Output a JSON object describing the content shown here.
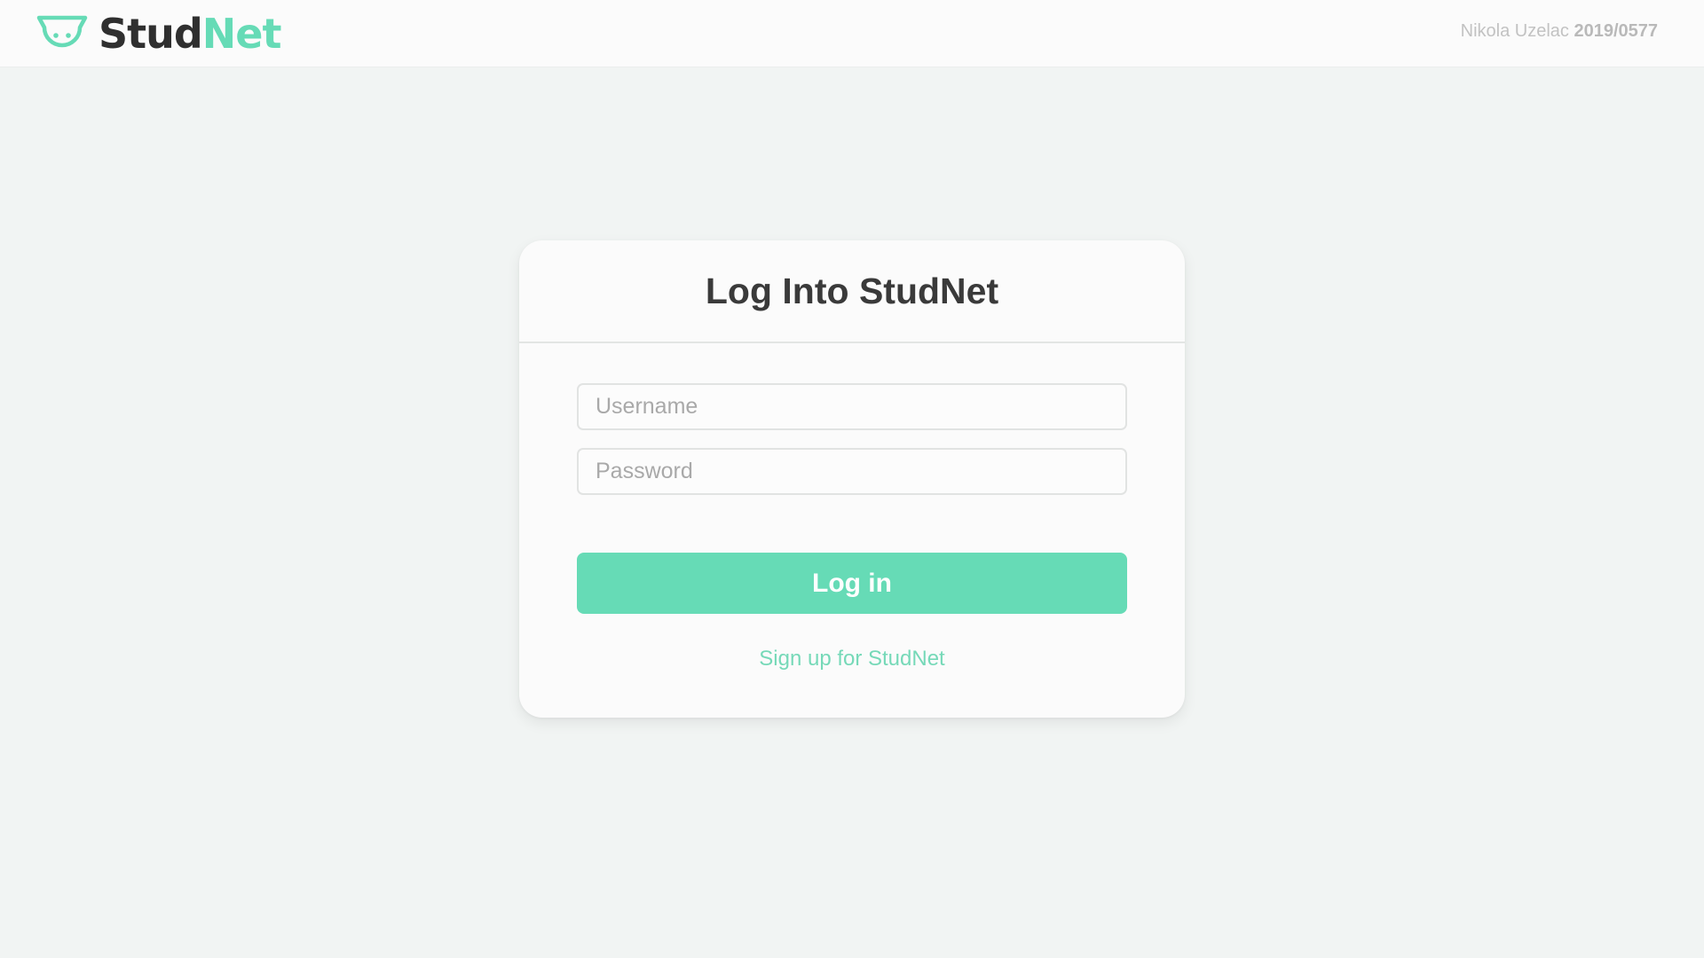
{
  "header": {
    "logo": {
      "icon": "cat-face-icon",
      "text_dark": "Stud",
      "text_accent": "Net"
    },
    "user": {
      "name": "Nikola Uzelac",
      "id": "2019/0577"
    }
  },
  "login_card": {
    "title": "Log Into StudNet",
    "username": {
      "value": "",
      "placeholder": "Username"
    },
    "password": {
      "value": "",
      "placeholder": "Password"
    },
    "submit_label": "Log in",
    "signup_link": "Sign up for StudNet"
  },
  "colors": {
    "accent": "#66dbb6",
    "text_dark": "#2f2f2f",
    "page_background": "#f1f4f3",
    "card_background": "#fbfbfb",
    "muted_text": "#c2c2c2"
  }
}
